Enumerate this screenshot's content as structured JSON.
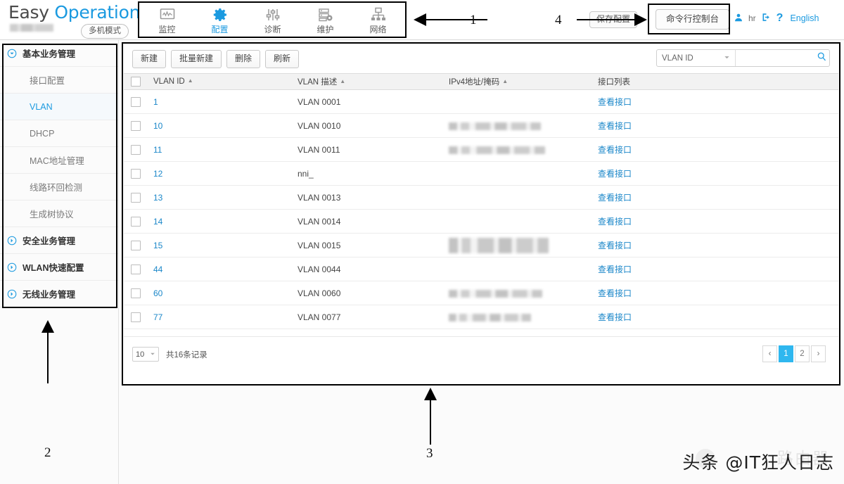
{
  "header": {
    "logo_easy": "Easy",
    "logo_operation": " Operation",
    "mode_pill": "多机模式",
    "nav": [
      {
        "label": "监控",
        "icon": "monitor-icon",
        "active": false
      },
      {
        "label": "配置",
        "icon": "gear-icon",
        "active": true
      },
      {
        "label": "诊断",
        "icon": "sliders-icon",
        "active": false
      },
      {
        "label": "维护",
        "icon": "server-gear-icon",
        "active": false
      },
      {
        "label": "网络",
        "icon": "network-topology-icon",
        "active": false
      }
    ],
    "save_button": "保存配置",
    "cli_button": "命令行控制台",
    "user_name": "hr",
    "help": "?",
    "language": "English",
    "accent_color": "#1b9ae0"
  },
  "sidebar": {
    "items": [
      {
        "label": "基本业务管理",
        "type": "group",
        "expanded": true
      },
      {
        "label": "接口配置",
        "type": "child",
        "active": false
      },
      {
        "label": "VLAN",
        "type": "child",
        "active": true
      },
      {
        "label": "DHCP",
        "type": "child",
        "active": false
      },
      {
        "label": "MAC地址管理",
        "type": "child",
        "active": false
      },
      {
        "label": "线路环回检测",
        "type": "child",
        "active": false
      },
      {
        "label": "生成树协议",
        "type": "child",
        "active": false
      },
      {
        "label": "安全业务管理",
        "type": "group",
        "expanded": false
      },
      {
        "label": "WLAN快速配置",
        "type": "group",
        "expanded": false
      },
      {
        "label": "无线业务管理",
        "type": "group",
        "expanded": false
      }
    ]
  },
  "toolbar": {
    "buttons": [
      "新建",
      "批量新建",
      "删除",
      "刷新"
    ],
    "search_field": "VLAN ID",
    "search_value": "",
    "search_placeholder": "",
    "search_icon": "search-icon"
  },
  "table": {
    "columns": [
      {
        "label": "VLAN ID",
        "sortable": true
      },
      {
        "label": "VLAN 描述",
        "sortable": true
      },
      {
        "label": "IPv4地址/掩码",
        "sortable": true
      },
      {
        "label": "接口列表",
        "sortable": false
      }
    ],
    "rows": [
      {
        "vlan_id": "1",
        "desc": "VLAN 0001",
        "ipv4": "",
        "ipv4_redacted": false,
        "ipv4_width": 0,
        "ipv4_lines": 1,
        "action": "查看接口"
      },
      {
        "vlan_id": "10",
        "desc": "VLAN 0010",
        "ipv4": "",
        "ipv4_redacted": true,
        "ipv4_width": 131,
        "ipv4_lines": 1,
        "action": "查看接口"
      },
      {
        "vlan_id": "11",
        "desc": "VLAN 0011",
        "ipv4": "",
        "ipv4_redacted": true,
        "ipv4_width": 137,
        "ipv4_lines": 1,
        "action": "查看接口"
      },
      {
        "vlan_id": "12",
        "desc": "nni_",
        "ipv4": "",
        "ipv4_redacted": false,
        "ipv4_width": 0,
        "ipv4_lines": 1,
        "action": "查看接口"
      },
      {
        "vlan_id": "13",
        "desc": "VLAN 0013",
        "ipv4": "",
        "ipv4_redacted": false,
        "ipv4_width": 0,
        "ipv4_lines": 1,
        "action": "查看接口"
      },
      {
        "vlan_id": "14",
        "desc": "VLAN 0014",
        "ipv4": "",
        "ipv4_redacted": false,
        "ipv4_width": 0,
        "ipv4_lines": 1,
        "action": "查看接口"
      },
      {
        "vlan_id": "15",
        "desc": "VLAN 0015",
        "ipv4": "",
        "ipv4_redacted": true,
        "ipv4_width": 142,
        "ipv4_lines": 2,
        "action": "查看接口"
      },
      {
        "vlan_id": "44",
        "desc": "VLAN 0044",
        "ipv4": "",
        "ipv4_redacted": false,
        "ipv4_width": 0,
        "ipv4_lines": 1,
        "action": "查看接口"
      },
      {
        "vlan_id": "60",
        "desc": "VLAN 0060",
        "ipv4": "",
        "ipv4_redacted": true,
        "ipv4_width": 133,
        "ipv4_lines": 1,
        "action": "查看接口"
      },
      {
        "vlan_id": "77",
        "desc": "VLAN 0077",
        "ipv4": "",
        "ipv4_redacted": true,
        "ipv4_width": 117,
        "ipv4_lines": 1,
        "action": "查看接口"
      }
    ]
  },
  "pagination": {
    "page_size": "10",
    "total_text": "共16条记录",
    "prev_icon": "chevron-left-icon",
    "next_icon": "chevron-right-icon",
    "pages": [
      "1",
      "2"
    ],
    "current_page": "1",
    "active_color": "#2fb7ef"
  },
  "annotations": [
    {
      "number": "1"
    },
    {
      "number": "2"
    },
    {
      "number": "3"
    },
    {
      "number": "4"
    }
  ],
  "watermark": {
    "text": "头条 @IT狂人日志",
    "ghost_text": "路由器"
  }
}
